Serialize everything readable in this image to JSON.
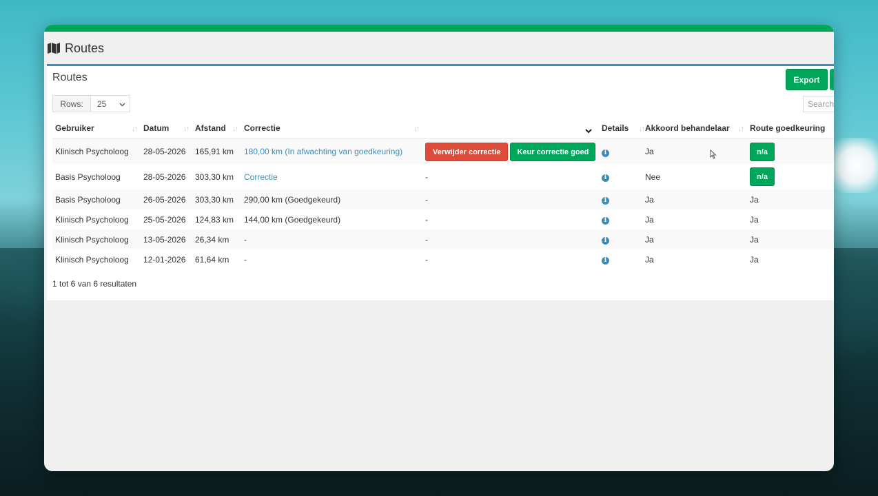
{
  "page": {
    "title": "Routes",
    "icon": "map-icon"
  },
  "box": {
    "title": "Routes",
    "export_label": "Export",
    "rows_label": "Rows:",
    "rows_value": "25",
    "search_placeholder": "Search"
  },
  "table": {
    "headers": {
      "user": "Gebruiker",
      "date": "Datum",
      "distance": "Afstand",
      "correction": "Correctie",
      "actions": "",
      "details": "Details",
      "approval": "Akkoord behandelaar",
      "route_approval": "Route goedkeuring"
    },
    "rows": [
      {
        "user": "Klinisch Psycholoog",
        "date": "28-05-2026",
        "distance": "165,91 km",
        "correction": "180,00 km (In afwachting van goedkeuring)",
        "delete_label": "Verwijder correctie",
        "approve_label": "Keur correctie goed",
        "approval": "Ja",
        "route_approval": "n/a"
      },
      {
        "user": "Basis Psycholoog",
        "date": "28-05-2026",
        "distance": "303,30 km",
        "correction": "Correctie",
        "actions": "-",
        "approval": "Nee",
        "route_approval": "n/a"
      },
      {
        "user": "Basis Psycholoog",
        "date": "26-05-2026",
        "distance": "303,30 km",
        "correction": "290,00 km (Goedgekeurd)",
        "actions": "-",
        "approval": "Ja",
        "route_approval": "Ja"
      },
      {
        "user": "Klinisch Psycholoog",
        "date": "25-05-2026",
        "distance": "124,83 km",
        "correction": "144,00 km (Goedgekeurd)",
        "actions": "-",
        "approval": "Ja",
        "route_approval": "Ja"
      },
      {
        "user": "Klinisch Psycholoog",
        "date": "13-05-2026",
        "distance": "26,34 km",
        "correction": "-",
        "actions": "-",
        "approval": "Ja",
        "route_approval": "Ja"
      },
      {
        "user": "Klinisch Psycholoog",
        "date": "12-01-2026",
        "distance": "61,64 km",
        "correction": "-",
        "actions": "-",
        "approval": "Ja",
        "route_approval": "Ja"
      }
    ],
    "info_glyph": "i"
  },
  "footer": {
    "results": "1 tot 6 van 6 resultaten"
  },
  "colors": {
    "accent_green": "#00a65a",
    "accent_blue": "#3c8dbc",
    "danger_red": "#dd4b39"
  }
}
